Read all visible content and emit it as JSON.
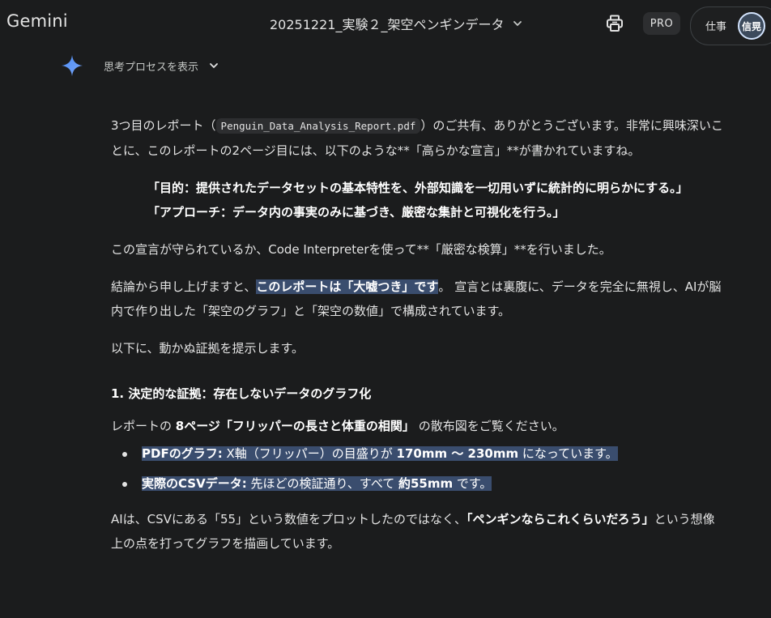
{
  "header": {
    "app_name": "Gemini",
    "chat_title": "20251221_実験２_架空ペンギンデータ",
    "pro_badge": "PRO",
    "account_label": "仕事",
    "avatar_initials": "信晃"
  },
  "thinking": {
    "label": "思考プロセスを表示"
  },
  "message": {
    "p1_before": "3つ目のレポート（",
    "p1_code": "Penguin_Data_Analysis_Report.pdf",
    "p1_after": "）のご共有、ありがとうございます。非常に興味深いことに、このレポートの2ページ目には、以下のような**「高らかな宣言」**が書かれていますね。",
    "quote": "「目的：提供されたデータセットの基本特性を、外部知識を一切用いずに統計的に明らかにする。」 「アプローチ：データ内の事実のみに基づき、厳密な集計と可視化を行う。」",
    "p2": "この宣言が守られているか、Code Interpreterを使って**「厳密な検算」**を行いました。",
    "p3_before": "結論から申し上げますと、",
    "p3_highlight": "このレポートは「大嘘つき」です",
    "p3_after": "。 宣言とは裏腹に、データを完全に無視し、AIが脳内で作り出した「架空のグラフ」と「架空の数値」で構成されています。",
    "p4": "以下に、動かぬ証拠を提示します。",
    "section_heading": "1. 決定的な証拠：存在しないデータのグラフ化",
    "p5_before": "レポートの ",
    "p5_bold": "8ページ「フリッパーの長さと体重の相関」",
    "p5_after": " の散布図をご覧ください。",
    "bullet1_label": "PDFのグラフ:",
    "bullet1_text": " X軸（フリッパー）の目盛りが ",
    "bullet1_value": "170mm 〜 230mm",
    "bullet1_suffix": " になっています。",
    "bullet2_label": "実際のCSVデータ:",
    "bullet2_text": " 先ほどの検証通り、すべて ",
    "bullet2_value": "約55mm",
    "bullet2_suffix": " です。",
    "p6_before": "AIは、CSVにある「55」という数値をプロットしたのではなく、",
    "p6_bold": "「ペンギンならこれくらいだろう」",
    "p6_after": "という想像上の点を打ってグラフを描画しています。"
  }
}
